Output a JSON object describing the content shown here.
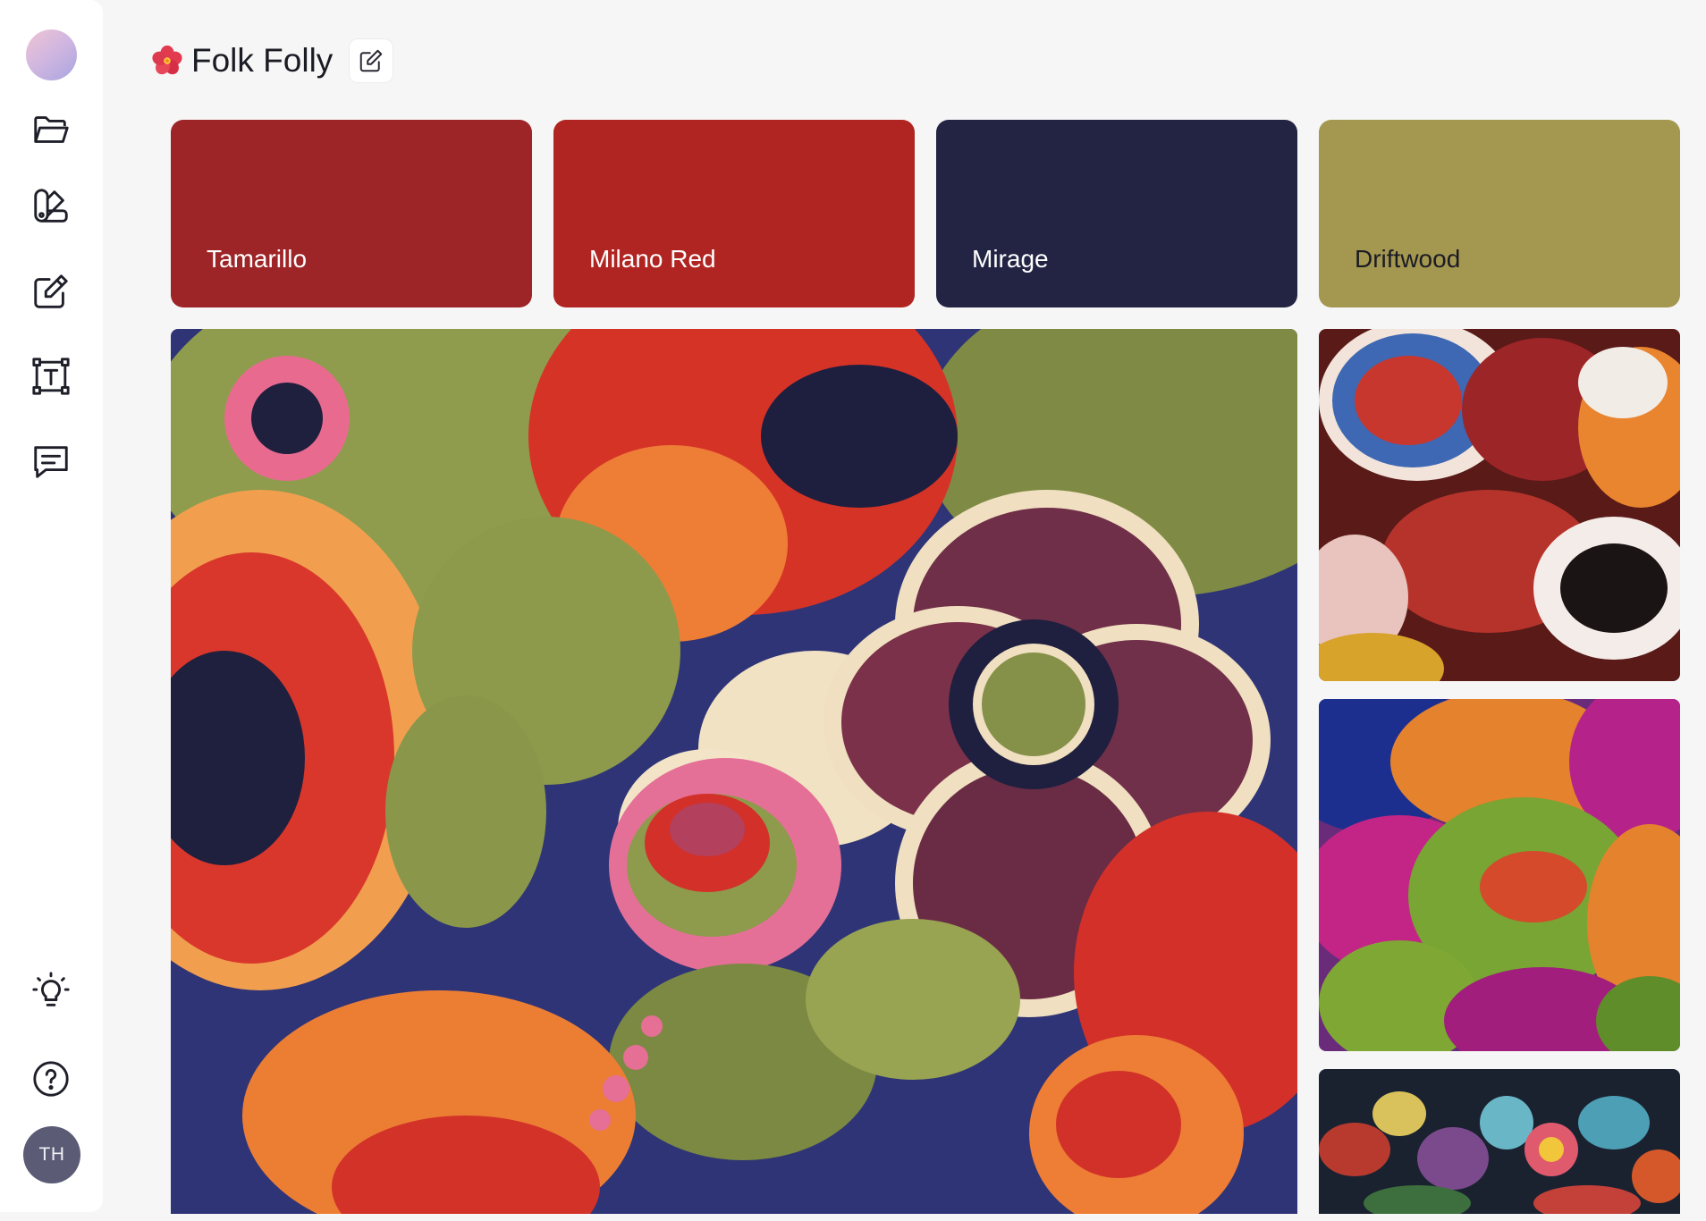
{
  "board": {
    "title": "Folk Folly",
    "title_emoji": "🌺"
  },
  "sidebar": {
    "items": [
      {
        "icon": "folder-icon"
      },
      {
        "icon": "swatch-book-icon"
      },
      {
        "icon": "pen-square-icon"
      },
      {
        "icon": "text-frame-icon"
      },
      {
        "icon": "comment-icon"
      },
      {
        "icon": "lightbulb-icon"
      },
      {
        "icon": "help-icon"
      }
    ],
    "avatar_initials": "TH"
  },
  "palette": [
    {
      "name": "Tamarillo",
      "hex": "#9d2427"
    },
    {
      "name": "Milano Red",
      "hex": "#b02421"
    },
    {
      "name": "Mirage",
      "hex": "#232444"
    },
    {
      "name": "Driftwood",
      "hex": "#a49850"
    }
  ],
  "images": [
    {
      "name": "large-floral-fabric-image"
    },
    {
      "name": "burgundy-print-fabric-image"
    },
    {
      "name": "psychedelic-leaf-fabric-image"
    },
    {
      "name": "ikat-fabric-image"
    }
  ]
}
